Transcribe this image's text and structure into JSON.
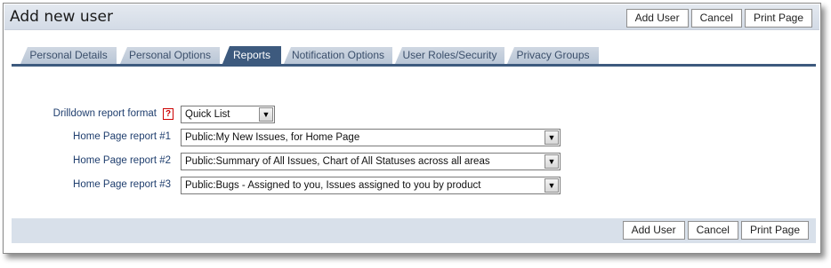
{
  "header": {
    "title": "Add new user",
    "buttons": {
      "add_user": "Add User",
      "cancel": "Cancel",
      "print_page": "Print Page"
    }
  },
  "tabs": [
    {
      "label": "Personal Details",
      "active": false
    },
    {
      "label": "Personal Options",
      "active": false
    },
    {
      "label": "Reports",
      "active": true
    },
    {
      "label": "Notification Options",
      "active": false
    },
    {
      "label": "User Roles/Security",
      "active": false
    },
    {
      "label": "Privacy Groups",
      "active": false
    }
  ],
  "form": {
    "drilldown": {
      "label": "Drilldown report format",
      "help": "?",
      "value": "Quick List",
      "help_icon": "help-question-icon"
    },
    "home1": {
      "label": "Home Page report #1",
      "value": "Public:My New Issues, for Home Page"
    },
    "home2": {
      "label": "Home Page report #2",
      "value": "Public:Summary of All Issues, Chart of All Statuses across all areas"
    },
    "home3": {
      "label": "Home Page report #3",
      "value": "Public:Bugs - Assigned to you, Issues assigned to you by product"
    }
  },
  "footer": {
    "buttons": {
      "add_user": "Add User",
      "cancel": "Cancel",
      "print_page": "Print Page"
    }
  },
  "icons": {
    "dropdown": "▼"
  },
  "colors": {
    "accent": "#3d5a7e",
    "label": "#1f3e6e",
    "header_bg": "#d3dbe6"
  }
}
